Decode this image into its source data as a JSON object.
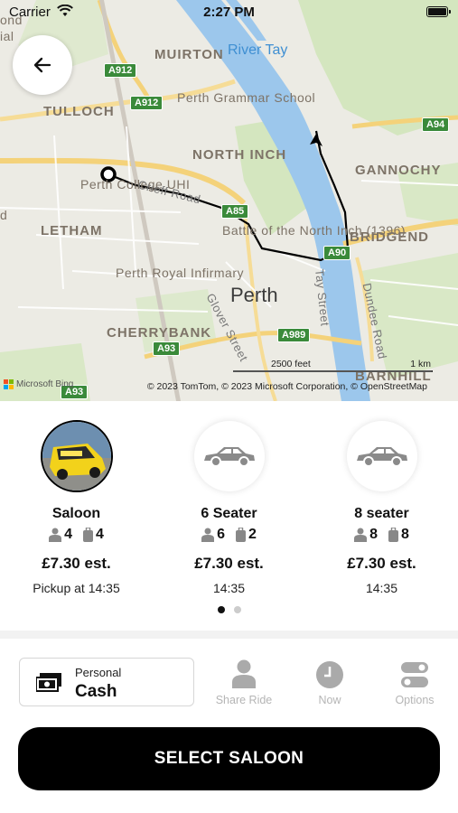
{
  "status_bar": {
    "carrier": "Carrier",
    "time": "2:27 PM"
  },
  "map": {
    "labels": {
      "muirton": "MUIRTON",
      "river": "River Tay",
      "tulloch": "TULLOCH",
      "grammar": "Perth Grammar School",
      "north_inch": "NORTH INCH",
      "gannochy": "GANNOCHY",
      "college": "Perth College UHI",
      "crieff": "Crieff Road",
      "letham": "LETHAM",
      "battle": "Battle of the North Inch (1396)",
      "bridgend": "BRIDGEND",
      "infirmary": "Perth Royal Infirmary",
      "perth": "Perth",
      "tay_street": "Tay Street",
      "dundee_road": "Dundee Road",
      "glover": "Glover Street",
      "cherrybank": "CHERRYBANK",
      "barnhill": "BARNHILL",
      "ond": "ond",
      "ial": "ial",
      "d": "d"
    },
    "shields": {
      "a912a": "A912",
      "a912b": "A912",
      "a94": "A94",
      "a85": "A85",
      "a90": "A90",
      "a989": "A989",
      "a93a": "A93",
      "a93b": "A93"
    },
    "scale": {
      "feet": "2500 feet",
      "km": "1 km"
    },
    "attribution": "© 2023 TomTom, © 2023 Microsoft Corporation, © OpenStreetMap",
    "ms_logo": "Microsoft Bing",
    "colors": {
      "water": "#9cc7ec",
      "park": "#cfe3b8",
      "road_major": "#f4d27a",
      "route": "#000000"
    }
  },
  "back_button": {
    "icon": "arrow-left-icon"
  },
  "vehicles": [
    {
      "name": "Saloon",
      "passengers": "4",
      "luggage": "4",
      "price": "£7.30 est.",
      "eta": "Pickup at 14:35",
      "selected": true,
      "icon": "taxi-photo"
    },
    {
      "name": "6 Seater",
      "passengers": "6",
      "luggage": "2",
      "price": "£7.30 est.",
      "eta": "14:35",
      "selected": false,
      "icon": "car-icon"
    },
    {
      "name": "8 seater",
      "passengers": "8",
      "luggage": "8",
      "price": "£7.30 est.",
      "eta": "14:35",
      "selected": false,
      "icon": "car-icon"
    }
  ],
  "pager": {
    "pages": 2,
    "current": 1
  },
  "payment": {
    "type": "Personal",
    "method": "Cash",
    "icon": "cash-icon"
  },
  "options": {
    "share": {
      "label": "Share Ride",
      "icon": "person-icon"
    },
    "now": {
      "label": "Now",
      "icon": "clock-icon"
    },
    "more": {
      "label": "Options",
      "icon": "toggles-icon"
    }
  },
  "select_button": {
    "label": "SELECT SALOON"
  }
}
